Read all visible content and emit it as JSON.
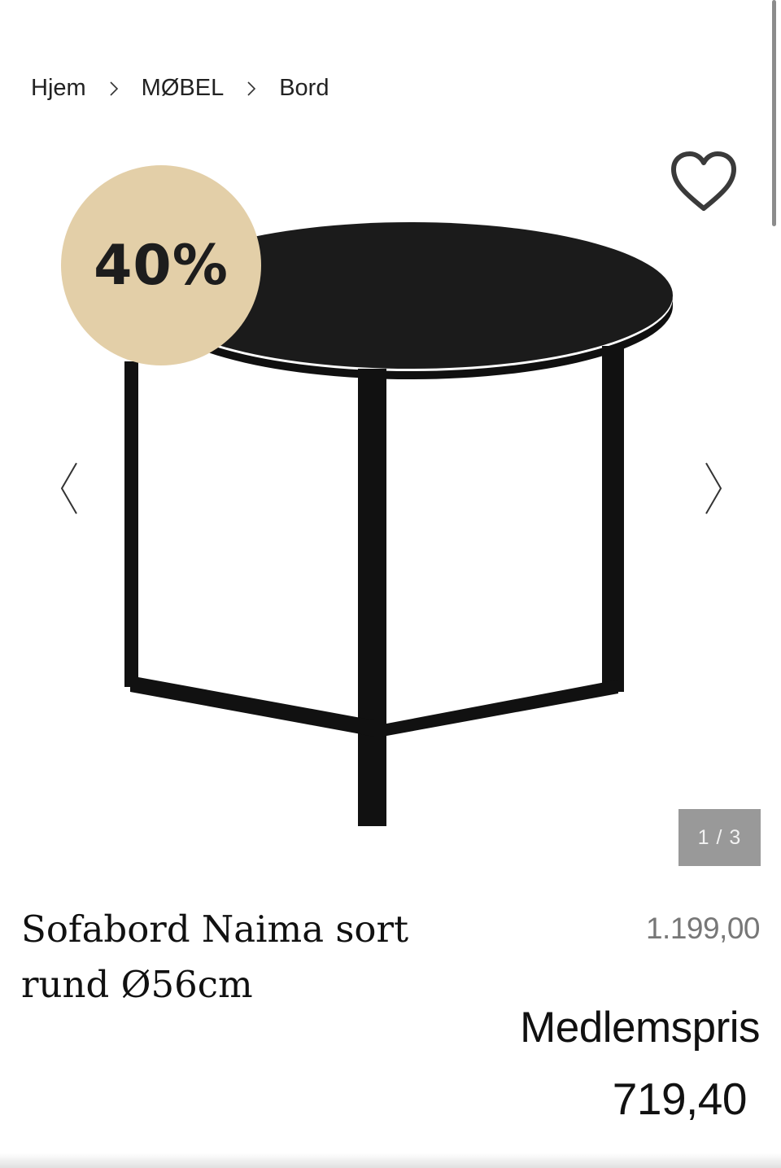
{
  "breadcrumb": {
    "items": [
      "Hjem",
      "MØBEL",
      "Bord"
    ]
  },
  "gallery": {
    "discount_badge": "40%",
    "counter": "1 / 3",
    "badge_color": "#e3cfa8",
    "counter_bg": "#999999"
  },
  "icons": {
    "wishlist": "heart-icon",
    "prev": "chevron-left-icon",
    "next": "chevron-right-icon",
    "separator": "chevron-right-small-icon"
  },
  "product": {
    "title": "Sofabord Naima sort rund Ø56cm",
    "old_price": "1.199,00",
    "member_label": "Medlemspris",
    "member_price": "719,40"
  }
}
